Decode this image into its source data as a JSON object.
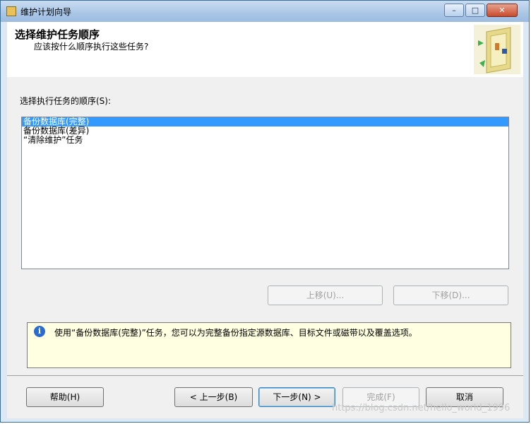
{
  "window": {
    "title": "维护计划向导"
  },
  "header": {
    "title": "选择维护任务顺序",
    "subtitle": "应该按什么顺序执行这些任务?"
  },
  "order": {
    "label": "选择执行任务的顺序(S):",
    "items": [
      "备份数据库(完整)",
      "备份数据库(差异)",
      "“清除维护”任务"
    ],
    "selected_index": 0
  },
  "move": {
    "up_label": "上移(U)...",
    "down_label": "下移(D)..."
  },
  "info": {
    "text": "使用“备份数据库(完整)”任务，您可以为完整备份指定源数据库、目标文件或磁带以及覆盖选项。"
  },
  "footer": {
    "help_label": "帮助(H)",
    "back_label": "< 上一步(B)",
    "next_label": "下一步(N) >",
    "finish_label": "完成(F)",
    "cancel_label": "取消"
  },
  "watermark": "https://blog.csdn.net/hello_world_1996",
  "colors": {
    "selection": "#3399ff",
    "info_bg": "#ffffe1",
    "titlebar": "#aac6e6"
  }
}
